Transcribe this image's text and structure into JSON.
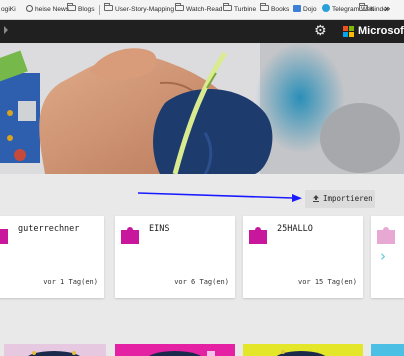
{
  "bookmarks": [
    {
      "label": "ogiKi",
      "icon": "none-icon"
    },
    {
      "label": "heise News",
      "icon": "globe-icon"
    },
    {
      "label": "Blogs",
      "icon": "folder-icon"
    },
    {
      "label": "User-Story-Mapping",
      "icon": "folder-icon"
    },
    {
      "label": "Watch-Read",
      "icon": "folder-icon"
    },
    {
      "label": "Turbine",
      "icon": "folder-icon"
    },
    {
      "label": "Books",
      "icon": "folder-icon"
    },
    {
      "label": "Dojo",
      "icon": "dojo-icon"
    },
    {
      "label": "Telegram Web",
      "icon": "telegram-icon"
    },
    {
      "label": "Kinder",
      "icon": "folder-icon"
    }
  ],
  "bookmarks_more": "»",
  "header": {
    "brand": "Microsoft",
    "settings_icon": "gear-icon",
    "colors": {
      "bar": "#202020",
      "ms_red": "#f25022",
      "ms_green": "#7fba00",
      "ms_blue": "#00a4ef",
      "ms_yellow": "#ffb900"
    }
  },
  "toolbar": {
    "import_label": "Importieren",
    "import_icon": "upload-icon",
    "annotation_arrow_color": "#1a1aff"
  },
  "projects": [
    {
      "title": "guterrechner",
      "date": "vor 1 Tag(en)",
      "icon": "puzzle-icon"
    },
    {
      "title": "EINS",
      "date": "vor 6 Tag(en)",
      "icon": "puzzle-icon"
    },
    {
      "title": "25HALLO",
      "date": "vor 15 Tag(en)",
      "icon": "puzzle-icon"
    }
  ],
  "colors": {
    "puzzle": "#c8179c",
    "puzzle_faded": "#e7a9d4",
    "chevron": "#5cc4dd",
    "card_bg": "#ffffff",
    "page_bg": "#e9e9ea"
  },
  "scroll_next_icon": "chevron-right-icon",
  "scroll_next": "›"
}
